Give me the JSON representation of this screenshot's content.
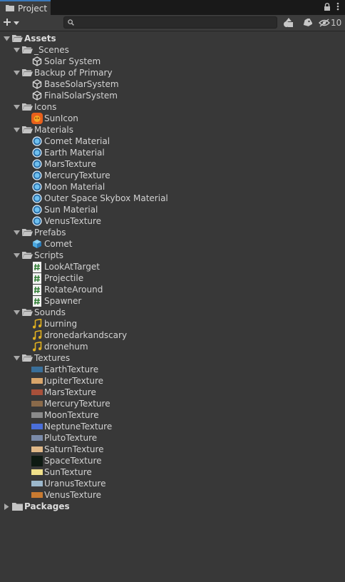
{
  "window": {
    "tab_title": "Project",
    "hidden_count": "10"
  },
  "search": {
    "value": ""
  },
  "tree": {
    "assets": "Assets",
    "scenes": {
      "label": "_Scenes",
      "items": [
        "Solar System"
      ]
    },
    "backup": {
      "label": "Backup of Primary",
      "items": [
        "BaseSolarSystem",
        "FinalSolarSystem"
      ]
    },
    "icons": {
      "label": "Icons",
      "items": [
        "SunIcon"
      ]
    },
    "materials": {
      "label": "Materials",
      "items": [
        "Comet Material",
        "Earth Material",
        "MarsTexture",
        "MercuryTexture",
        "Moon Material",
        "Outer Space Skybox Material",
        "Sun Material",
        "VenusTexture"
      ]
    },
    "prefabs": {
      "label": "Prefabs",
      "items": [
        "Comet"
      ]
    },
    "scripts": {
      "label": "Scripts",
      "items": [
        "LookAtTarget",
        "Projectile",
        "RotateAround",
        "Spawner"
      ]
    },
    "sounds": {
      "label": "Sounds",
      "items": [
        "burning",
        "dronedarkandscary",
        "dronehum"
      ]
    },
    "textures": {
      "label": "Textures",
      "items": [
        "EarthTexture",
        "JupiterTexture",
        "MarsTexture",
        "MercuryTexture",
        "MoonTexture",
        "NeptuneTexture",
        "PlutoTexture",
        "SaturnTexture",
        "SpaceTexture",
        "SunTexture",
        "UranusTexture",
        "VenusTexture"
      ]
    },
    "packages": "Packages"
  },
  "texture_colors": [
    "#3a6f9a",
    "#d9a56a",
    "#a8503a",
    "#8a6a4a",
    "#8a8a8a",
    "#4a6ed8",
    "#7a8aa8",
    "#e0b888",
    "#0e1a12",
    "#f0e08a",
    "#9cb8cc",
    "#c87a30"
  ],
  "colors": {
    "accent": "#3a79bb",
    "background": "#383838",
    "script_icon": "#2e7d32",
    "sound_icon": "#e0b020",
    "material_icon": "#4aa8e0",
    "prefab_icon": "#4aa8e0"
  }
}
